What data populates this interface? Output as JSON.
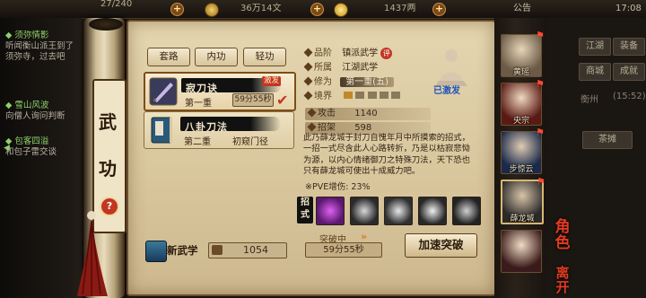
{
  "topbar": {
    "stamina": "27/240",
    "silver": "36万14文",
    "gold": "1437两",
    "announcement": "公告",
    "time": "17:08"
  },
  "quests": [
    {
      "title": "◆ 须弥情影",
      "body": "听闻衡山派王到了须弥寺，过去吧"
    },
    {
      "title": "◆ 雪山风波",
      "body": "向僧人询问判断"
    },
    {
      "title": "◆ 包客四溢",
      "body": "和包子雷交谈"
    }
  ],
  "side_tab": {
    "chars": [
      "武",
      "功"
    ],
    "help": "?"
  },
  "tabs": [
    "套路",
    "内功",
    "轻功"
  ],
  "skills": [
    {
      "name": "寂刀诀",
      "rank": "第一重",
      "status_badge": "激发",
      "timer": "59分55秒"
    },
    {
      "name": "八卦刀法",
      "rank": "第二重",
      "desc": "初窥门径"
    }
  ],
  "detail": {
    "grade_label": "品阶",
    "grade_value": "镇派武学",
    "grade_badge": "评",
    "origin_label": "所属",
    "origin_value": "江湖武学",
    "level_label": "修为",
    "level_value": "第一重(五)",
    "realm_label": "境界",
    "activated": "已激发",
    "attack_label": "攻击",
    "attack_value": "1140",
    "parry_label": "招架",
    "parry_value": "598",
    "description": "此乃薛龙城于封刀自愧年月中所摸索的招式，一招一式尽含此人心路转折，乃是以枯寂悲恸为源，以内心情绪御刀之特殊刀法，天下恐也只有薛龙城可使出十成威力吧。",
    "pve_bonus": "※PVE增伤: 23%",
    "moves_label": "招式",
    "breakthrough_label": "突破中",
    "breakthrough_timer": "59分55秒",
    "accelerate_button": "加速突破"
  },
  "footer": {
    "new_skill_label": "新武学",
    "points": "1054"
  },
  "heroes": [
    {
      "name": "黄瑶"
    },
    {
      "name": "央宗"
    },
    {
      "name": "步惊云"
    },
    {
      "name": "薛龙城"
    },
    {
      "name": ""
    }
  ],
  "right_menu": {
    "row1": [
      "江湖",
      "装备"
    ],
    "row2": [
      "商城",
      "成就"
    ],
    "location": "衡州",
    "coords": "(15:52)",
    "teahouse": "茶摊",
    "role_label": "角色",
    "leave_label": "离开"
  },
  "colors": {
    "accent_red": "#c23622",
    "parchment": "#dccaa0",
    "ink": "#111111"
  }
}
